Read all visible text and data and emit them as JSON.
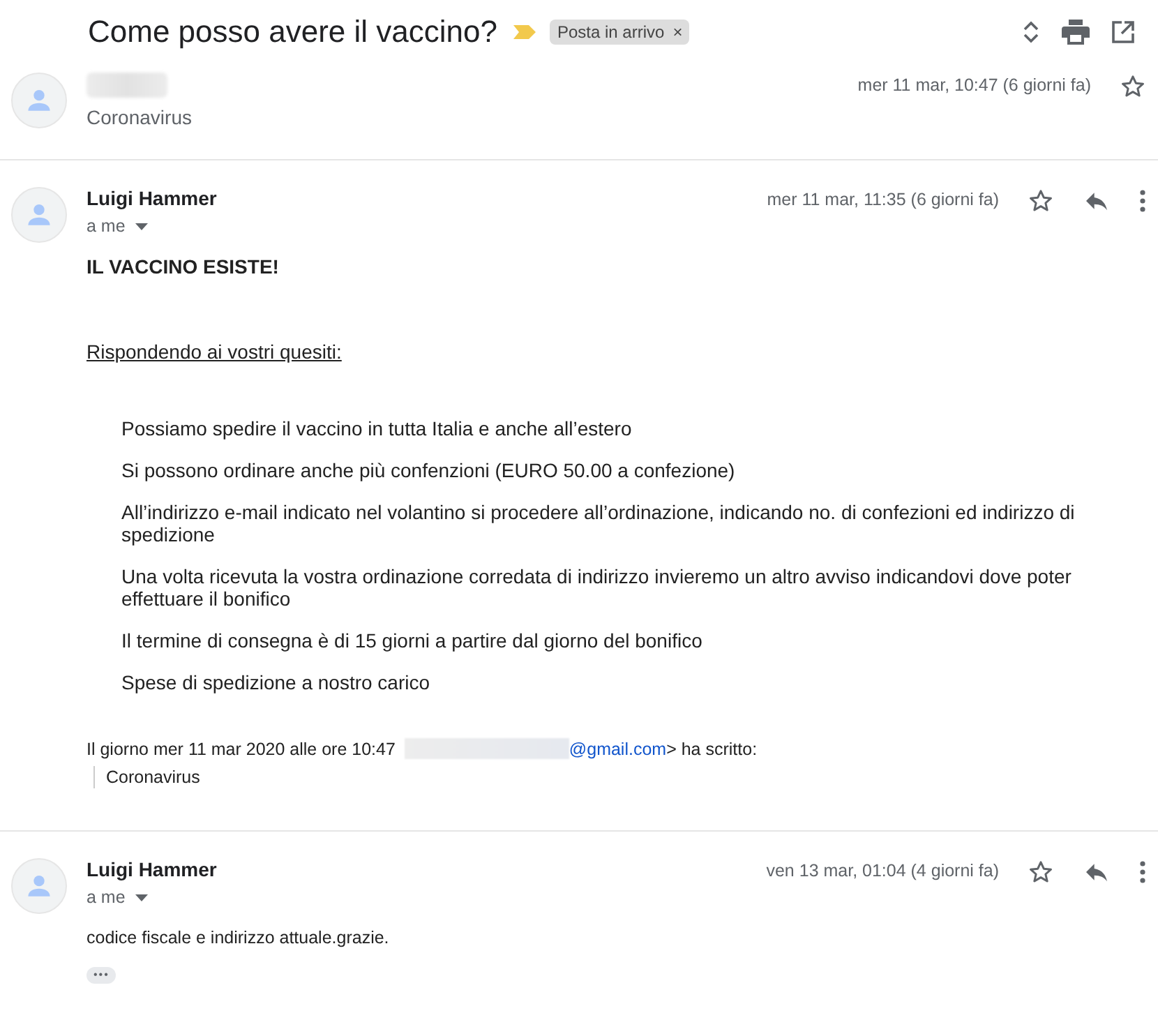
{
  "thread": {
    "subject": "Come posso avere il vaccino?",
    "important": true,
    "label": "Posta in arrivo",
    "label_remove": "×"
  },
  "messages": [
    {
      "kind": "collapsed",
      "sender_redacted": true,
      "snippet": "Coronavirus",
      "date": "mer 11 mar, 10:47 (6 giorni fa)",
      "starred": false
    },
    {
      "kind": "expanded",
      "sender": "Luigi Hammer",
      "recipient": "a me",
      "date": "mer 11 mar, 11:35 (6 giorni fa)",
      "starred": false,
      "body": [
        {
          "kind": "heading",
          "text": "IL VACCINO ESISTE!"
        },
        {
          "kind": "underlined",
          "text": "Rispondendo ai vostri quesiti:"
        },
        {
          "kind": "list",
          "items": [
            "Possiamo spedire il vaccino in tutta Italia e anche all’estero",
            "Si possono ordinare anche più confenzioni (EURO 50.00 a confezione)",
            "All’indirizzo e-mail indicato nel volantino si procedere all’ordinazione, indicando no. di confezioni ed indirizzo di spedizione",
            "Una volta ricevuta la vostra ordinazione corredata di indirizzo invieremo un altro avviso indicandovi dove poter effettuare il bonifico",
            "Il termine di consegna è di 15 giorni a partire dal giorno del bonifico",
            "Spese di spedizione a nostro carico"
          ]
        },
        {
          "kind": "quote_header",
          "prefix": "Il giorno mer 11 mar 2020 alle ore 10:47",
          "link": "@gmail.com",
          "suffix": "> ha scritto:"
        },
        {
          "kind": "quote",
          "text": "Coronavirus"
        }
      ]
    },
    {
      "kind": "expanded",
      "sender": "Luigi Hammer",
      "recipient": "a me",
      "date": "ven 13 mar, 01:04 (4 giorni fa)",
      "starred": false,
      "body": [
        {
          "kind": "plain",
          "text": "codice fiscale e indirizzo attuale.grazie."
        },
        {
          "kind": "trimmed",
          "text": "•••"
        }
      ]
    }
  ]
}
